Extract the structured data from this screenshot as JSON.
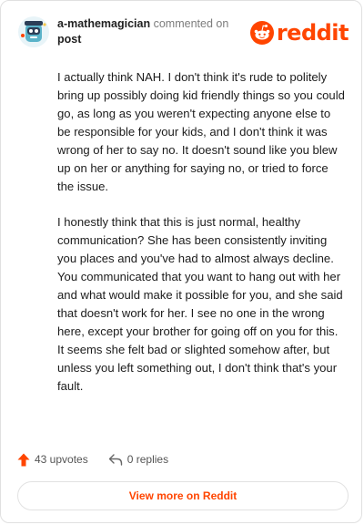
{
  "comment": {
    "username": "a-mathemagician",
    "action_text": "commented on",
    "target": "post",
    "paragraphs": [
      "I actually think NAH. I don't think it's rude to politely bring up possibly doing kid friendly things so you could go, as long as you weren't expecting anyone else to be responsible for your kids, and I don't think it was wrong of her to say no. It doesn't sound like you blew up on her or anything for saying no, or tried to force the issue.",
      "I honestly think that this is just normal, healthy communication? She has been consistently inviting you places and you've had to almost always decline. You communicated that you want to hang out with her and what would make it possible for you, and she said that doesn't work for her. I see no one in the wrong here, except your brother for going off on you for this. It seems she felt bad or slighted somehow after, but unless you left something out, I don't think that's your fault."
    ]
  },
  "brand": {
    "name": "reddit",
    "color": "#ff4500"
  },
  "stats": {
    "upvotes": "43 upvotes",
    "replies": "0 replies"
  },
  "cta": {
    "label": "View more on Reddit"
  },
  "icons": {
    "avatar": "snoo-avatar",
    "logo": "reddit-alien-icon",
    "upvote": "upvote-arrow-icon",
    "reply": "reply-arrow-icon"
  }
}
